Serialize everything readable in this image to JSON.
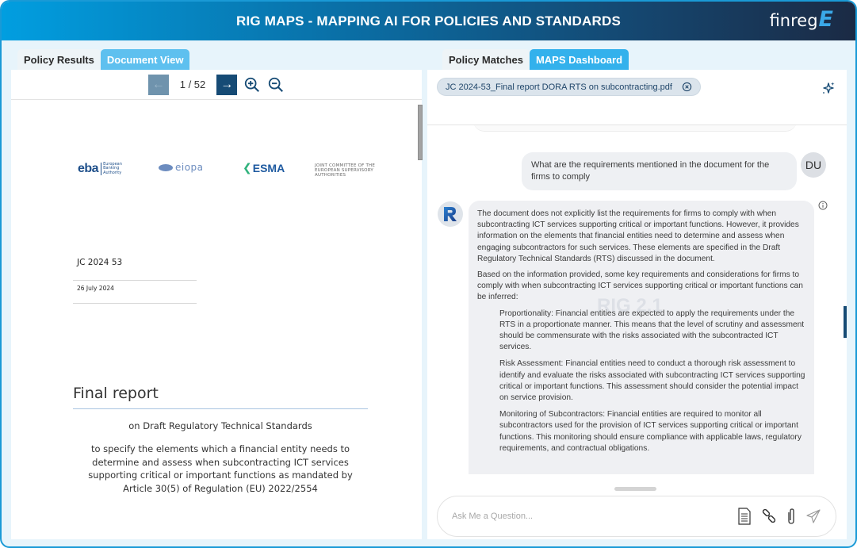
{
  "header": {
    "title": "RIG MAPS - MAPPING AI FOR POLICIES AND STANDARDS",
    "brand_text": "finreg",
    "brand_mark": "E"
  },
  "left_tabs": [
    {
      "label": "Policy Results",
      "active": false
    },
    {
      "label": "Document View",
      "active": true
    }
  ],
  "right_tabs": [
    {
      "label": "Policy Matches",
      "active": false
    },
    {
      "label": "MAPS Dashboard",
      "active": true
    }
  ],
  "pager": {
    "prev_icon": "arrow-left-icon",
    "next_icon": "arrow-right-icon",
    "current_page": 1,
    "total_pages": 52,
    "page_text": "1 / 52",
    "zoom_in_icon": "zoom-in-icon",
    "zoom_out_icon": "zoom-out-icon"
  },
  "document": {
    "logos": {
      "eba": {
        "mark": "eba",
        "text": "European Banking Authority"
      },
      "eiopa": {
        "word": "eiopa"
      },
      "esma": {
        "word": "ESMA"
      },
      "jc": {
        "text": "JOINT COMMITTEE OF THE EUROPEAN SUPERVISORY AUTHORITIES"
      }
    },
    "reference": "JC 2024 53",
    "date": "26 July 2024",
    "title": "Final report",
    "subtitle": "on Draft Regulatory Technical Standards",
    "body": "to specify the elements which a financial entity needs to determine and assess when subcontracting ICT services supporting critical or important functions as mandated by Article 30(5) of Regulation (EU) 2022/2554"
  },
  "chat": {
    "file_chip": "JC 2024-53_Final report DORA RTS on subcontracting.pdf",
    "user_message": "What are the requirements mentioned in the document for the firms to comply",
    "user_initials": "DU",
    "bot_avatar_letter": "R",
    "watermark": "RIG 2.1",
    "bot_paragraphs": [
      "The document does not explicitly list the requirements for firms to comply with when subcontracting ICT services supporting critical or important functions. However, it provides information on the elements that financial entities need to determine and assess when engaging subcontractors for such services. These elements are specified in the Draft Regulatory Technical Standards (RTS) discussed in the document.",
      "Based on the information provided, some key requirements and considerations for firms to comply with when subcontracting ICT services supporting critical or important functions can be inferred:"
    ],
    "bot_items": [
      "Proportionality: Financial entities are expected to apply the requirements under the RTS in a proportionate manner. This means that the level of scrutiny and assessment should be commensurate with the risks associated with the subcontracted ICT services.",
      "Risk Assessment: Financial entities need to conduct a thorough risk assessment to identify and evaluate the risks associated with subcontracting ICT services supporting critical or important functions. This assessment should consider the potential impact on service provision.",
      "Monitoring of Subcontractors: Financial entities are required to monitor all subcontractors used for the provision of ICT services supporting critical or important functions. This monitoring should ensure compliance with applicable laws, regulatory requirements, and contractual obligations."
    ],
    "input": {
      "placeholder": "Ask Me a Question...",
      "value": ""
    }
  },
  "colors": {
    "accent": "#33b1ec",
    "navy": "#164b75",
    "frame": "#1a9ad6"
  }
}
